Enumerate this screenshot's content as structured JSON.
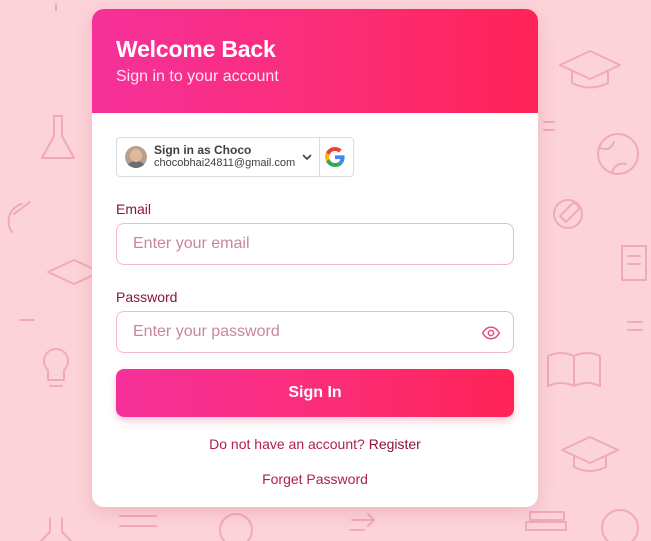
{
  "header": {
    "title": "Welcome Back",
    "subtitle": "Sign in to your account"
  },
  "google_account": {
    "name_line": "Sign in as Choco",
    "email": "chocobhai24811@gmail.com",
    "provider_icon": "google-g-icon"
  },
  "email_field": {
    "label": "Email",
    "placeholder": "Enter your email",
    "value": ""
  },
  "password_field": {
    "label": "Password",
    "placeholder": "Enter your password",
    "value": "",
    "toggle_icon": "eye-icon"
  },
  "actions": {
    "signin_label": "Sign In",
    "register_prompt": "Do not have an account?",
    "register_label": "Register",
    "forgot_label": "Forget Password"
  },
  "colors": {
    "background": "#fcd3d9",
    "gradient_start": "#f5309a",
    "gradient_end": "#ff2357",
    "label_text": "#8a1538",
    "link_text": "#b0204e"
  }
}
